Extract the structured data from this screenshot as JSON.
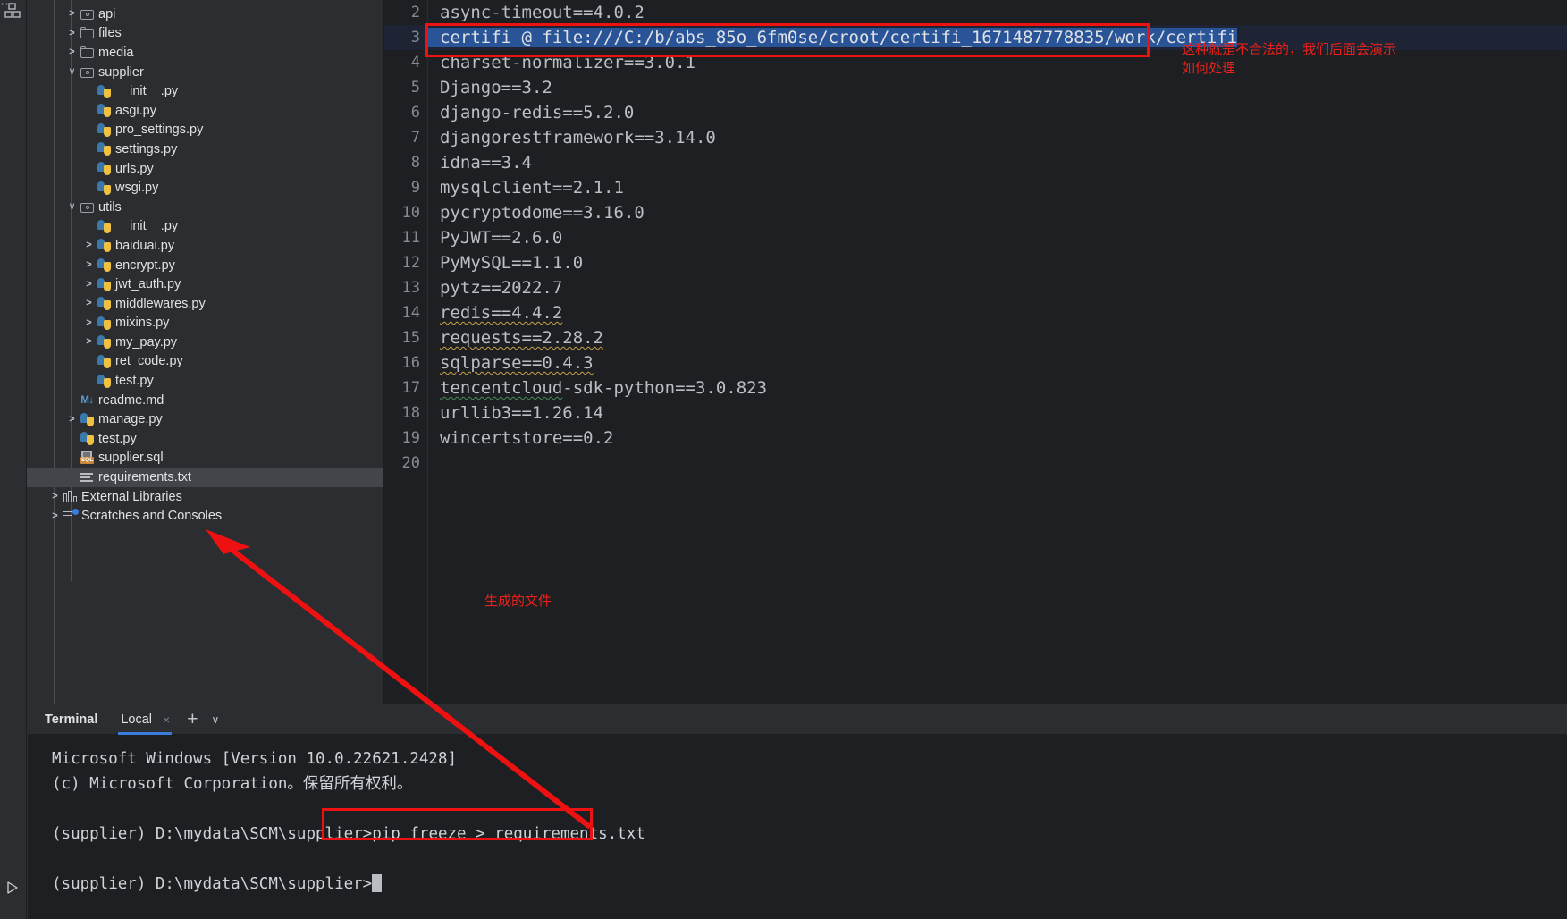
{
  "rail": {
    "structure_icon": "structure-icon",
    "more_icon": "more-options-icon",
    "more_glyph": "⋯",
    "run_icon": "run-icon"
  },
  "project_tree": {
    "items": [
      {
        "label": "api",
        "indent": 1,
        "arrow": "closed",
        "icon": "folder-source"
      },
      {
        "label": "files",
        "indent": 1,
        "arrow": "closed",
        "icon": "folder-plain"
      },
      {
        "label": "media",
        "indent": 1,
        "arrow": "closed",
        "icon": "folder-plain"
      },
      {
        "label": "supplier",
        "indent": 1,
        "arrow": "open",
        "icon": "folder-source"
      },
      {
        "label": "__init__.py",
        "indent": 2,
        "arrow": "none",
        "icon": "python"
      },
      {
        "label": "asgi.py",
        "indent": 2,
        "arrow": "none",
        "icon": "python"
      },
      {
        "label": "pro_settings.py",
        "indent": 2,
        "arrow": "none",
        "icon": "python"
      },
      {
        "label": "settings.py",
        "indent": 2,
        "arrow": "none",
        "icon": "python"
      },
      {
        "label": "urls.py",
        "indent": 2,
        "arrow": "none",
        "icon": "python"
      },
      {
        "label": "wsgi.py",
        "indent": 2,
        "arrow": "none",
        "icon": "python"
      },
      {
        "label": "utils",
        "indent": 1,
        "arrow": "open",
        "icon": "folder-source"
      },
      {
        "label": "__init__.py",
        "indent": 2,
        "arrow": "none",
        "icon": "python"
      },
      {
        "label": "baiduai.py",
        "indent": 2,
        "arrow": "closed",
        "icon": "python"
      },
      {
        "label": "encrypt.py",
        "indent": 2,
        "arrow": "closed",
        "icon": "python"
      },
      {
        "label": "jwt_auth.py",
        "indent": 2,
        "arrow": "closed",
        "icon": "python"
      },
      {
        "label": "middlewares.py",
        "indent": 2,
        "arrow": "closed",
        "icon": "python"
      },
      {
        "label": "mixins.py",
        "indent": 2,
        "arrow": "closed",
        "icon": "python"
      },
      {
        "label": "my_pay.py",
        "indent": 2,
        "arrow": "closed",
        "icon": "python"
      },
      {
        "label": "ret_code.py",
        "indent": 2,
        "arrow": "none",
        "icon": "python"
      },
      {
        "label": "test.py",
        "indent": 2,
        "arrow": "none",
        "icon": "python"
      },
      {
        "label": "readme.md",
        "indent": 1,
        "arrow": "none",
        "icon": "markdown"
      },
      {
        "label": "manage.py",
        "indent": 1,
        "arrow": "closed",
        "icon": "python"
      },
      {
        "label": "test.py",
        "indent": 1,
        "arrow": "none",
        "icon": "python"
      },
      {
        "label": "supplier.sql",
        "indent": 1,
        "arrow": "none",
        "icon": "sql"
      },
      {
        "label": "requirements.txt",
        "indent": 1,
        "arrow": "none",
        "icon": "textfile",
        "selected": true
      },
      {
        "label": "External Libraries",
        "indent": 0,
        "arrow": "closed",
        "icon": "external-libraries"
      },
      {
        "label": "Scratches and Consoles",
        "indent": 0,
        "arrow": "closed",
        "icon": "scratches"
      }
    ]
  },
  "editor": {
    "lines": [
      {
        "num": "2",
        "text": "async-timeout==4.0.2",
        "style": "plain"
      },
      {
        "num": "3",
        "text": "certifi @ file:///C:/b/abs_85o_6fm0se/croot/certifi_1671487778835/work/certifi",
        "style": "selected"
      },
      {
        "num": "4",
        "text": "charset-normalizer==3.0.1",
        "style": "plain"
      },
      {
        "num": "5",
        "text": "Django==3.2",
        "style": "plain"
      },
      {
        "num": "6",
        "text": "django-redis==5.2.0",
        "style": "plain"
      },
      {
        "num": "7",
        "text": "djangorestframework==3.14.0",
        "style": "plain"
      },
      {
        "num": "8",
        "text": "idna==3.4",
        "style": "plain"
      },
      {
        "num": "9",
        "text": "mysqlclient==2.1.1",
        "style": "plain"
      },
      {
        "num": "10",
        "text": "pycryptodome==3.16.0",
        "style": "plain"
      },
      {
        "num": "11",
        "text": "PyJWT==2.6.0",
        "style": "plain"
      },
      {
        "num": "12",
        "text": "PyMySQL==1.1.0",
        "style": "plain"
      },
      {
        "num": "13",
        "text": "pytz==2022.7",
        "style": "plain"
      },
      {
        "num": "14",
        "text": "redis==4.4.2",
        "style": "squiggle-orange"
      },
      {
        "num": "15",
        "text": "requests==2.28.2",
        "style": "squiggle-orange"
      },
      {
        "num": "16",
        "text": "sqlparse==0.4.3",
        "style": "squiggle-orange"
      },
      {
        "num": "17",
        "text": "tencentcloud-sdk-python==3.0.823",
        "style": "squiggle-green-partial",
        "squiggle_part": "tencentcloud",
        "rest": "-sdk-python==3.0.823"
      },
      {
        "num": "18",
        "text": "urllib3==1.26.14",
        "style": "plain"
      },
      {
        "num": "19",
        "text": "wincertstore==0.2",
        "style": "plain"
      },
      {
        "num": "20",
        "text": "",
        "style": "plain"
      }
    ]
  },
  "annotations": {
    "illegal_note": "这种就是不合法的，我们后面会演示\n如何处理",
    "generated_file_note": "生成的文件",
    "highlight_color": "#ee1111"
  },
  "terminal": {
    "title": "Terminal",
    "tab_label": "Local",
    "close_glyph": "×",
    "add_glyph": "+",
    "chevron_glyph": "∨",
    "lines": [
      "Microsoft Windows [Version 10.0.22621.2428]",
      "(c) Microsoft Corporation。保留所有权利。",
      "",
      ""
    ],
    "prompt": "(supplier) D:\\mydata\\SCM\\supplier>",
    "command": "pip freeze > requirements.txt",
    "prompt2": "(supplier) D:\\mydata\\SCM\\supplier>"
  }
}
